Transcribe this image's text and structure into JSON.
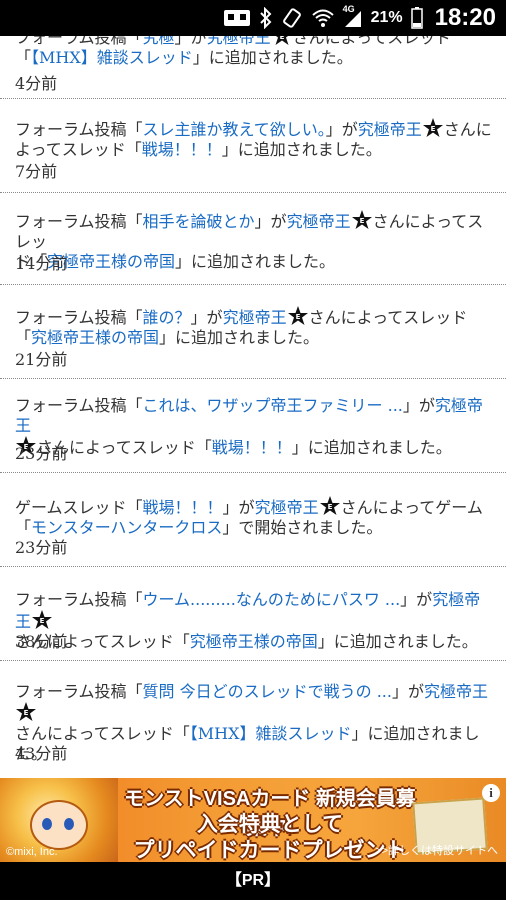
{
  "status_bar": {
    "icons": [
      "sim-icon",
      "bluetooth-icon",
      "vibrate-icon",
      "wifi-icon",
      "signal-4g-icon",
      "battery-icon"
    ],
    "network_label": "4G",
    "battery": "21%",
    "time": "18:20"
  },
  "feed": [
    {
      "prefix": "フォーラム投稿「",
      "title": "究極",
      "mid": "」が",
      "user": "究極帝王",
      "thread_intro": "さんによってスレッド",
      "thread": "【MHX】雑談スレッド",
      "suffix": "」に追加されました。",
      "time": "4分前"
    },
    {
      "prefix": "フォーラム投稿「",
      "title": "スレ主誰か教えて欲しい。",
      "mid": "」が",
      "user": "究極帝王",
      "thread_intro": "さんによってスレッド「",
      "thread": "戦場！！！",
      "suffix": "」に追加されました。",
      "time": "7分前"
    },
    {
      "prefix": "フォーラム投稿「",
      "title": "相手を論破とか",
      "mid": "」が",
      "user": "究極帝王",
      "thread_intro": "さんによってスレッド「",
      "thread": "究極帝王様の帝国",
      "suffix": "」に追加されました。",
      "time": "14分前"
    },
    {
      "prefix": "フォーラム投稿「",
      "title": "誰の？",
      "mid": "」が",
      "user": "究極帝王",
      "thread_intro": "さんによってスレッド「",
      "thread": "究極帝王様の帝国",
      "suffix": "」に追加されました。",
      "time": "21分前"
    },
    {
      "prefix": "フォーラム投稿「",
      "title": "これは、ワザップ帝王ファミリー ...",
      "mid": "」が",
      "user": "究極帝王",
      "thread_intro": "さんによってスレッド「",
      "thread": "戦場！！！",
      "suffix": "」に追加されました。",
      "time": "23分前"
    },
    {
      "prefix": "ゲームスレッド「",
      "title": "戦場！！！",
      "mid": "」が",
      "user": "究極帝王",
      "thread_intro": "さんによってゲーム「",
      "thread": "モンスターハンタークロス",
      "suffix": "」で開始されました。",
      "time": "23分前"
    },
    {
      "prefix": "フォーラム投稿「",
      "title": "ウーム.........なんのためにパスワ ...",
      "mid": "」が",
      "user": "究極帝王",
      "thread_intro": "さんによってスレッド「",
      "thread": "究極帝王様の帝国",
      "suffix": "」に追加されました。",
      "time": "38分前"
    },
    {
      "prefix": "フォーラム投稿「",
      "title": "質問 今日どのスレッドで戦うの ...",
      "mid": "」が",
      "user": "究極帝王",
      "thread_intro": "さんによってスレッド「",
      "thread": "【MHX】雑談スレッド",
      "suffix": "」に追加されました。",
      "time": "43分前"
    }
  ],
  "banner": {
    "line1": "モンストVISAカード 新規会員募集中!",
    "line2": "入会特典として",
    "line3": "プリペイドカードプレゼント",
    "copyright": "©mixi, Inc.",
    "more": ">>詳しくは特設サイトへ",
    "info": "i"
  },
  "pr_label": "【PR】",
  "colors": {
    "link": "#1a6bc4",
    "status_bg": "#000000",
    "banner_orange": "#f39a33"
  }
}
